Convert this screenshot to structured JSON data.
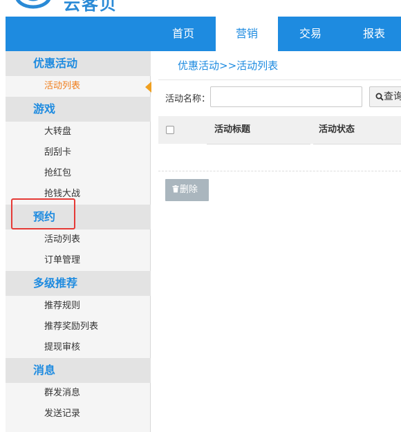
{
  "brand": {
    "logo_text": "云客贝"
  },
  "nav": {
    "tabs": [
      {
        "label": "首页"
      },
      {
        "label": "营销",
        "active": true
      },
      {
        "label": "交易"
      },
      {
        "label": "报表"
      }
    ]
  },
  "sidebar": {
    "groups": [
      {
        "title": "优惠活动",
        "items": [
          {
            "label": "活动列表",
            "active": true
          }
        ]
      },
      {
        "title": "游戏",
        "items": [
          {
            "label": "大转盘"
          },
          {
            "label": "刮刮卡"
          },
          {
            "label": "抢红包"
          },
          {
            "label": "抢钱大战"
          }
        ]
      },
      {
        "title": "预约",
        "items": [
          {
            "label": "活动列表"
          },
          {
            "label": "订单管理"
          }
        ]
      },
      {
        "title": "多级推荐",
        "items": [
          {
            "label": "推荐规则"
          },
          {
            "label": "推荐奖励列表"
          },
          {
            "label": "提现审核"
          }
        ]
      },
      {
        "title": "消息",
        "items": [
          {
            "label": "群发消息"
          },
          {
            "label": "发送记录"
          }
        ]
      }
    ]
  },
  "main": {
    "breadcrumb": "优惠活动>>活动列表",
    "search": {
      "label": "活动名称：",
      "value": "",
      "placeholder": "",
      "button_label": "查询"
    },
    "table": {
      "columns": [
        "活动标题",
        "活动状态"
      ]
    },
    "delete_label": "删除"
  },
  "colors": {
    "primary": "#1e8be0",
    "active_item": "#f07d1a",
    "highlight": "#e53935"
  }
}
